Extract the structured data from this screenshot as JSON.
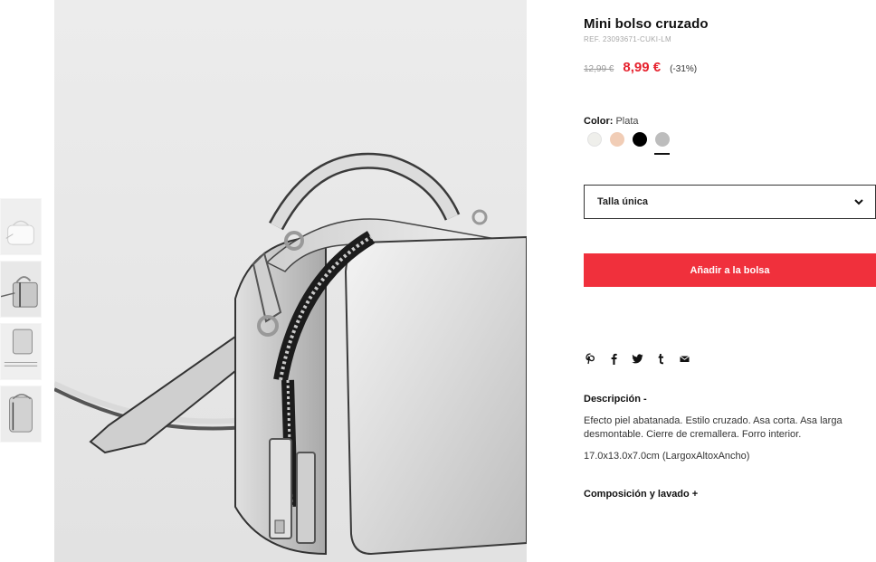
{
  "product": {
    "title": "Mini bolso cruzado",
    "ref": "REF. 23093671-CUKI-LM",
    "old_price": "12,99 €",
    "sale_price": "8,99 €",
    "discount": "(-31%)"
  },
  "colors": {
    "label": "Color:",
    "selected": "Plata",
    "swatches": [
      {
        "name": "off-white",
        "hex": "#efefeb"
      },
      {
        "name": "nude",
        "hex": "#f1cdb6"
      },
      {
        "name": "black",
        "hex": "#000000"
      },
      {
        "name": "silver",
        "hex": "#bdbdbd"
      }
    ]
  },
  "size": {
    "value": "Talla única",
    "icon": "chevron-down-icon"
  },
  "cart": {
    "add_label": "Añadir a la bolsa",
    "color": "#f0303c"
  },
  "share": {
    "icons": [
      "pinterest-icon",
      "facebook-icon",
      "twitter-icon",
      "tumblr-icon",
      "email-icon"
    ]
  },
  "description": {
    "title": "Descripción -",
    "text": "Efecto piel abatanada. Estilo cruzado. Asa corta. Asa larga desmontable. Cierre de cremallera. Forro interior.",
    "dimensions": "17.0x13.0x7.0cm (LargoxAltoxAncho)"
  },
  "composition": {
    "title": "Composición y lavado +"
  }
}
